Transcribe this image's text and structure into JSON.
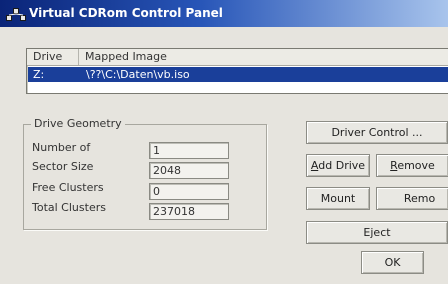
{
  "window": {
    "title": "Virtual CDRom Control Panel"
  },
  "drive_list": {
    "columns": [
      "Drive",
      "Mapped Image"
    ],
    "rows": [
      {
        "drive": "Z:",
        "image": "\\??\\C:\\Daten\\vb.iso",
        "selected": true
      }
    ]
  },
  "geometry": {
    "title": "Drive Geometry",
    "fields": [
      {
        "label": "Number of",
        "value": "1"
      },
      {
        "label": "Sector Size",
        "value": "2048"
      },
      {
        "label": "Free Clusters",
        "value": "0"
      },
      {
        "label": "Total Clusters",
        "value": "237018"
      }
    ]
  },
  "buttons": {
    "driver_control": "Driver Control ...",
    "add_drive": "Add Drive",
    "add_drive_mnemonic": "A",
    "add_drive_rest": "dd Drive",
    "remove_drive": "Remove",
    "remove_drive_mnemonic": "R",
    "remove_drive_rest": "emove",
    "mount": "Mount",
    "remove_mount": "Remo",
    "eject": "Eject",
    "ok": "OK"
  },
  "colors": {
    "titlebar_start": "#0a2478",
    "titlebar_end": "#a8c4ec",
    "selection": "#1a3f9a"
  },
  "icons": {
    "app": "cdrom-app-icon"
  }
}
